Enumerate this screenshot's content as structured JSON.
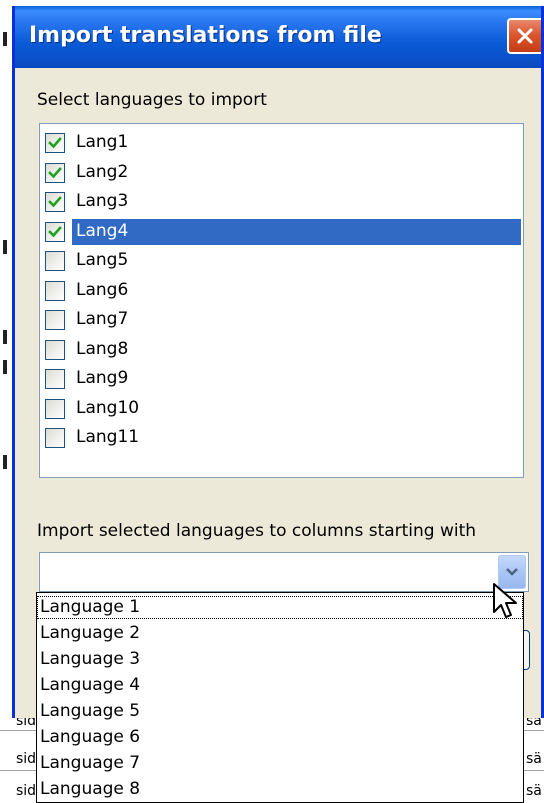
{
  "dialog": {
    "title": "Import translations from file",
    "languages_label": "Select languages to import",
    "languages": [
      {
        "label": "Lang1",
        "checked": true,
        "selected": false
      },
      {
        "label": "Lang2",
        "checked": true,
        "selected": false
      },
      {
        "label": "Lang3",
        "checked": true,
        "selected": false
      },
      {
        "label": "Lang4",
        "checked": true,
        "selected": true
      },
      {
        "label": "Lang5",
        "checked": false,
        "selected": false
      },
      {
        "label": "Lang6",
        "checked": false,
        "selected": false
      },
      {
        "label": "Lang7",
        "checked": false,
        "selected": false
      },
      {
        "label": "Lang8",
        "checked": false,
        "selected": false
      },
      {
        "label": "Lang9",
        "checked": false,
        "selected": false
      },
      {
        "label": "Lang10",
        "checked": false,
        "selected": false
      },
      {
        "label": "Lang11",
        "checked": false,
        "selected": false
      }
    ],
    "columns_label": "Import selected languages to columns starting with",
    "combo_value": "",
    "dropdown_options": [
      "Language 1",
      "Language 2",
      "Language 3",
      "Language 4",
      "Language 5",
      "Language 6",
      "Language 7",
      "Language 8"
    ]
  },
  "background": {
    "row_fragments": [
      "sid",
      "sid",
      "sid"
    ],
    "right_fragments": [
      "sä",
      "sä",
      "sä"
    ]
  },
  "colors": {
    "titlebar": "#0a5ad6",
    "selection": "#316ac5",
    "dialog_face": "#ece9d8",
    "check": "#21a121"
  },
  "icons": {
    "close": "close-icon",
    "checkmark": "checkmark-icon",
    "dropdown": "chevron-down-icon",
    "cursor": "mouse-pointer-icon"
  }
}
